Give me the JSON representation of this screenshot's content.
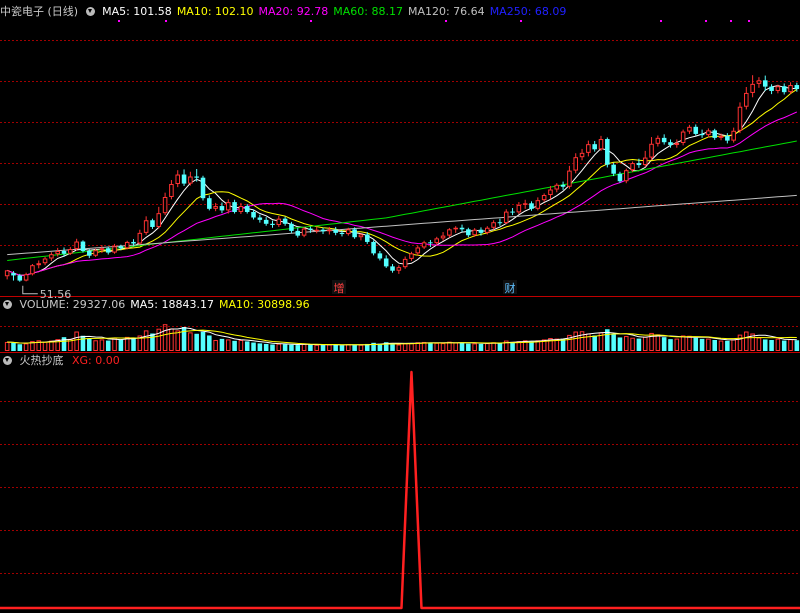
{
  "colors": {
    "up": "#ff3232",
    "down": "#54ffff",
    "ma5": "#ffffff",
    "ma10": "#ffff00",
    "ma20": "#ff00ff",
    "ma60": "#00e000",
    "ma120": "#c0c0c0",
    "ma250": "#2020ff",
    "grid": "#a00000",
    "xg": "#ff2020"
  },
  "icons": {
    "panel_toggle": "chevron-down-circle-icon",
    "low_marker": "arrow-left-icon"
  },
  "price_panel": {
    "title": "中瓷电子 (日线)",
    "ma_labels": [
      {
        "name": "ma5",
        "text": "MA5: 101.58"
      },
      {
        "name": "ma10",
        "text": "MA10: 102.10"
      },
      {
        "name": "ma20",
        "text": "MA20: 92.78"
      },
      {
        "name": "ma60",
        "text": "MA60: 88.17"
      },
      {
        "name": "ma120",
        "text": "MA120: 76.64"
      },
      {
        "name": "ma250",
        "text": "MA250: 68.09"
      }
    ],
    "low_label": "51.56",
    "events": [
      {
        "text": "增"
      },
      {
        "text": "财"
      }
    ]
  },
  "volume_panel": {
    "labels": [
      {
        "name": "vol",
        "text": "VOLUME: 29327.06"
      },
      {
        "name": "ma5",
        "text": "MA5: 18843.17"
      },
      {
        "name": "ma10",
        "text": "MA10: 30898.96"
      }
    ]
  },
  "indicator_panel": {
    "title": "火热抄底",
    "value_label": "XG: 0.00"
  },
  "chart_data": {
    "type": "candlestick",
    "price": {
      "ylim": [
        49,
        118
      ],
      "candles": [
        [
          53.0,
          54.5,
          52.2,
          53.8
        ],
        [
          53.8,
          53.2,
          51.9,
          54.3
        ],
        [
          53.2,
          51.9,
          51.6,
          53.6
        ],
        [
          51.9,
          53.5,
          51.7,
          53.9
        ],
        [
          53.5,
          55.8,
          53.2,
          56.1
        ],
        [
          55.8,
          56.3,
          55.0,
          57.0
        ],
        [
          56.3,
          57.5,
          55.8,
          57.9
        ],
        [
          57.5,
          58.6,
          56.9,
          59.1
        ],
        [
          58.6,
          59.4,
          58.0,
          60.2
        ],
        [
          59.4,
          58.7,
          57.9,
          60.3
        ],
        [
          58.7,
          59.9,
          58.4,
          60.4
        ],
        [
          59.9,
          61.8,
          59.5,
          62.5
        ],
        [
          61.8,
          59.4,
          59.0,
          62.1
        ],
        [
          59.4,
          58.2,
          57.6,
          59.9
        ],
        [
          58.2,
          59.6,
          57.9,
          60.0
        ],
        [
          59.6,
          60.1,
          58.9,
          60.9
        ],
        [
          60.1,
          59.0,
          58.5,
          60.5
        ],
        [
          59.0,
          60.6,
          58.7,
          61.2
        ],
        [
          60.6,
          60.1,
          59.6,
          61.0
        ],
        [
          60.1,
          61.7,
          59.8,
          62.0
        ],
        [
          61.7,
          61.3,
          60.7,
          62.4
        ],
        [
          61.3,
          64.0,
          61.0,
          64.8
        ],
        [
          64.0,
          67.2,
          63.5,
          68.2
        ],
        [
          67.2,
          65.5,
          65.0,
          67.6
        ],
        [
          65.5,
          69.0,
          65.1,
          70.6
        ],
        [
          69.0,
          73.1,
          68.5,
          74.2
        ],
        [
          73.1,
          76.4,
          72.5,
          77.4
        ],
        [
          76.4,
          78.8,
          75.6,
          79.9
        ],
        [
          78.8,
          76.5,
          75.9,
          80.1
        ],
        [
          76.5,
          78.3,
          76.0,
          79.5
        ],
        [
          78.3,
          78.0,
          77.0,
          80.2
        ],
        [
          78.0,
          72.8,
          72.2,
          78.5
        ],
        [
          72.8,
          70.1,
          69.7,
          73.5
        ],
        [
          70.1,
          70.8,
          69.5,
          71.6
        ],
        [
          70.8,
          69.7,
          69.0,
          71.7
        ],
        [
          69.7,
          71.8,
          68.9,
          72.5
        ],
        [
          71.8,
          69.3,
          68.9,
          72.4
        ],
        [
          69.3,
          70.8,
          68.8,
          71.6
        ],
        [
          70.8,
          69.3,
          68.9,
          71.3
        ],
        [
          69.3,
          67.9,
          67.4,
          69.9
        ],
        [
          67.9,
          67.3,
          66.6,
          68.6
        ],
        [
          67.3,
          66.3,
          65.8,
          68.0
        ],
        [
          66.3,
          66.0,
          65.3,
          67.1
        ],
        [
          66.0,
          67.6,
          65.5,
          68.3
        ],
        [
          67.6,
          66.3,
          65.8,
          68.1
        ],
        [
          66.3,
          64.5,
          64.0,
          66.8
        ],
        [
          64.5,
          63.3,
          62.8,
          65.2
        ],
        [
          63.3,
          65.1,
          62.9,
          65.5
        ],
        [
          65.1,
          64.8,
          64.0,
          65.6
        ],
        [
          64.8,
          64.8,
          63.9,
          65.6
        ],
        [
          64.8,
          64.4,
          63.7,
          65.3
        ],
        [
          64.4,
          64.8,
          63.6,
          65.5
        ],
        [
          64.8,
          64.0,
          63.4,
          65.5
        ],
        [
          64.0,
          63.7,
          63.1,
          64.6
        ],
        [
          63.7,
          64.9,
          63.3,
          65.3
        ],
        [
          64.9,
          62.9,
          62.5,
          65.4
        ],
        [
          62.9,
          63.6,
          62.1,
          63.9
        ],
        [
          63.6,
          61.7,
          61.2,
          64.2
        ],
        [
          61.7,
          58.8,
          58.3,
          62.1
        ],
        [
          58.8,
          57.5,
          57.0,
          59.4
        ],
        [
          57.5,
          55.5,
          55.1,
          58.3
        ],
        [
          55.5,
          54.4,
          53.9,
          56.1
        ],
        [
          54.4,
          55.3,
          53.6,
          55.8
        ],
        [
          55.3,
          57.4,
          54.9,
          58.0
        ],
        [
          57.4,
          58.8,
          56.9,
          59.2
        ],
        [
          58.8,
          60.3,
          58.2,
          60.8
        ],
        [
          60.3,
          61.6,
          59.9,
          62.0
        ],
        [
          61.6,
          61.4,
          60.4,
          62.2
        ],
        [
          61.4,
          62.6,
          60.9,
          63.0
        ],
        [
          62.6,
          63.3,
          62.0,
          64.2
        ],
        [
          63.3,
          64.9,
          62.8,
          65.2
        ],
        [
          64.9,
          65.3,
          64.0,
          65.7
        ],
        [
          65.3,
          64.9,
          64.2,
          66.1
        ],
        [
          64.9,
          63.4,
          62.9,
          65.3
        ],
        [
          63.4,
          64.8,
          63.0,
          65.2
        ],
        [
          64.8,
          64.0,
          63.3,
          65.4
        ],
        [
          64.0,
          65.3,
          63.6,
          65.7
        ],
        [
          65.3,
          66.7,
          64.8,
          67.2
        ],
        [
          66.7,
          66.5,
          65.8,
          67.6
        ],
        [
          66.5,
          69.4,
          66.2,
          70.0
        ],
        [
          69.4,
          69.2,
          68.5,
          70.3
        ],
        [
          69.2,
          71.1,
          68.8,
          71.8
        ],
        [
          71.1,
          71.5,
          70.1,
          72.4
        ],
        [
          71.5,
          70.1,
          69.6,
          72.0
        ],
        [
          70.1,
          72.3,
          69.7,
          73.0
        ],
        [
          72.3,
          73.6,
          71.9,
          74.0
        ],
        [
          73.6,
          75.0,
          72.5,
          75.9
        ],
        [
          75.0,
          76.2,
          74.3,
          76.6
        ],
        [
          76.2,
          75.7,
          74.9,
          77.0
        ],
        [
          75.7,
          79.8,
          75.2,
          81.0
        ],
        [
          79.8,
          83.2,
          79.1,
          84.2
        ],
        [
          83.2,
          84.3,
          82.4,
          85.3
        ],
        [
          84.3,
          86.5,
          83.4,
          87.4
        ],
        [
          86.5,
          85.2,
          84.6,
          87.3
        ],
        [
          85.2,
          87.8,
          84.8,
          88.6
        ],
        [
          87.8,
          81.3,
          80.6,
          88.2
        ],
        [
          81.3,
          79.0,
          78.4,
          81.8
        ],
        [
          79.0,
          77.1,
          76.7,
          79.5
        ],
        [
          77.1,
          79.9,
          76.6,
          80.3
        ],
        [
          79.9,
          81.7,
          79.4,
          82.1
        ],
        [
          81.7,
          81.2,
          80.5,
          82.8
        ],
        [
          81.2,
          83.1,
          80.7,
          84.8
        ],
        [
          83.1,
          86.6,
          82.5,
          88.3
        ],
        [
          86.6,
          88.1,
          85.9,
          88.7
        ],
        [
          88.1,
          87.0,
          86.4,
          89.0
        ],
        [
          87.0,
          86.3,
          85.6,
          87.7
        ],
        [
          86.3,
          86.8,
          85.6,
          87.7
        ],
        [
          86.8,
          89.7,
          86.2,
          90.2
        ],
        [
          89.7,
          90.9,
          89.1,
          91.4
        ],
        [
          90.9,
          89.1,
          88.7,
          91.5
        ],
        [
          89.1,
          88.8,
          88.1,
          90.2
        ],
        [
          88.8,
          90.0,
          88.2,
          90.5
        ],
        [
          90.0,
          88.1,
          87.6,
          90.4
        ],
        [
          88.1,
          88.6,
          87.5,
          89.2
        ],
        [
          88.6,
          87.4,
          86.7,
          89.3
        ],
        [
          87.4,
          89.9,
          86.9,
          90.7
        ],
        [
          89.9,
          96.0,
          89.3,
          97.1
        ],
        [
          96.0,
          99.5,
          95.3,
          101.0
        ],
        [
          99.5,
          101.8,
          98.4,
          104.0
        ],
        [
          101.8,
          102.7,
          100.8,
          103.5
        ],
        [
          102.7,
          101.1,
          100.0,
          103.9
        ],
        [
          101.1,
          100.0,
          99.2,
          101.7
        ],
        [
          100.0,
          101.2,
          99.4,
          101.6
        ],
        [
          101.2,
          99.7,
          99.1,
          101.9
        ],
        [
          99.7,
          101.5,
          99.3,
          102.2
        ],
        [
          101.5,
          100.5,
          99.8,
          102.1
        ]
      ],
      "ma": {
        "ma5": 101.58,
        "ma10": 102.1,
        "ma20": 92.78,
        "ma60": 88.17,
        "ma120": 76.64,
        "ma250": 68.09
      }
    },
    "volume": {
      "ylim": [
        0,
        62000
      ],
      "values": [
        16000,
        14500,
        12000,
        13500,
        17500,
        19000,
        16500,
        18500,
        21000,
        24500,
        21500,
        34500,
        27000,
        22000,
        19000,
        20500,
        18500,
        23500,
        19500,
        25000,
        22000,
        27500,
        36500,
        31000,
        39500,
        47500,
        40000,
        36500,
        42500,
        33000,
        30500,
        34000,
        27500,
        19500,
        21500,
        20500,
        18000,
        19500,
        17000,
        15000,
        13500,
        12500,
        11500,
        13000,
        12000,
        11000,
        10500,
        12500,
        11500,
        11000,
        10500,
        11500,
        11000,
        10000,
        12000,
        10500,
        11000,
        12500,
        14500,
        13000,
        15500,
        14000,
        11500,
        13500,
        14000,
        15500,
        16000,
        13500,
        14500,
        14000,
        16500,
        15000,
        14500,
        13000,
        13500,
        12500,
        14000,
        15500,
        13500,
        18500,
        16000,
        17500,
        19000,
        16500,
        19000,
        20500,
        23000,
        22000,
        21500,
        28500,
        34500,
        35000,
        31000,
        27500,
        33000,
        38500,
        29500,
        24000,
        26500,
        23500,
        22000,
        25500,
        32000,
        29500,
        24500,
        21000,
        22000,
        27500,
        27000,
        23500,
        21500,
        22000,
        19500,
        18500,
        18000,
        20500,
        29000,
        34500,
        31000,
        24000,
        20500,
        19500,
        22000,
        18500,
        21000,
        19000
      ]
    },
    "indicator": {
      "name": "XG",
      "ylim": [
        0,
        1
      ],
      "values_note": "0 everywhere except a single spike to 1",
      "spike_index": 64,
      "spike_value": 1
    }
  }
}
